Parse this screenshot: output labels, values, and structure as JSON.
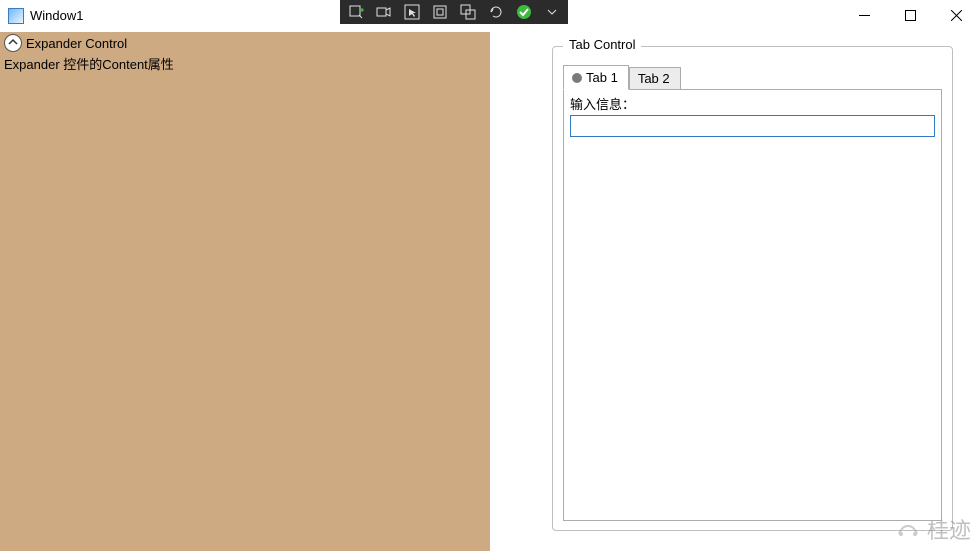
{
  "window": {
    "title": "Window1"
  },
  "expander": {
    "header": "Expander Control",
    "content": "Expander 控件的Content属性"
  },
  "groupbox": {
    "header": "Tab Control"
  },
  "tabs": [
    {
      "label": "Tab 1",
      "active": true
    },
    {
      "label": "Tab 2",
      "active": false
    }
  ],
  "form": {
    "inputLabel": "输入信息：",
    "inputValue": ""
  },
  "watermark": "桂迹"
}
